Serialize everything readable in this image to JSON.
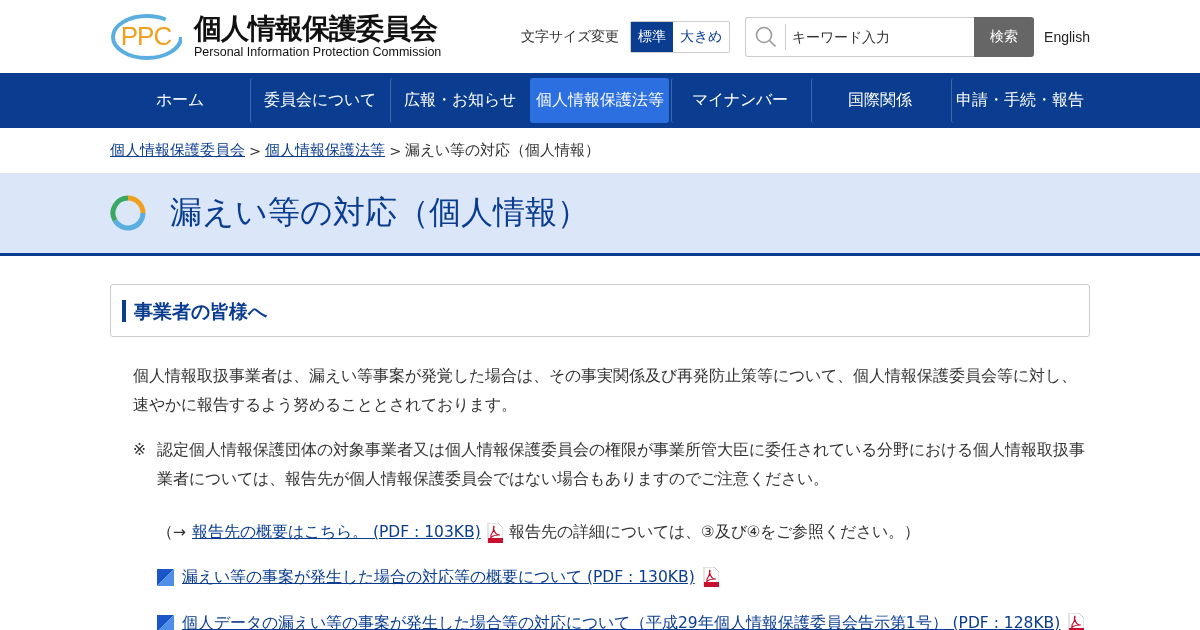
{
  "header": {
    "logo_mark": "PPC",
    "logo_title": "個人情報保護委員会",
    "logo_subtitle": "Personal Information Protection Commission",
    "font_size_label": "文字サイズ変更",
    "font_size_options": [
      {
        "label": "標準",
        "selected": true
      },
      {
        "label": "大きめ",
        "selected": false
      }
    ],
    "search": {
      "placeholder": "キーワード入力",
      "button": "検索"
    },
    "language_link": "English"
  },
  "nav": {
    "items": [
      {
        "label": "ホーム",
        "selected": false
      },
      {
        "label": "委員会について",
        "selected": false
      },
      {
        "label": "広報・お知らせ",
        "selected": false
      },
      {
        "label": "個人情報保護法等",
        "selected": true
      },
      {
        "label": "マイナンバー",
        "selected": false
      },
      {
        "label": "国際関係",
        "selected": false
      },
      {
        "label": "申請・手続・報告",
        "selected": false
      }
    ]
  },
  "breadcrumb": {
    "separator": ">",
    "items": [
      {
        "label": "個人情報保護委員会",
        "kind": "link"
      },
      {
        "label": "個人情報保護法等",
        "kind": "link"
      },
      {
        "label": "漏えい等の対応（個人情報）",
        "kind": "current"
      }
    ]
  },
  "page_title": "漏えい等の対応（個人情報）",
  "section": {
    "heading": "事業者の皆様へ",
    "intro": "個人情報取扱事業者は、漏えい等事案が発覚した場合は、その事実関係及び再発防止策等について、個人情報保護委員会等に対し、速やかに報告するよう努めることとされております。",
    "note": {
      "mark": "※",
      "text": "認定個人情報保護団体の対象事業者又は個人情報保護委員会の権限が事業所管大臣に委任されている分野における個人情報取扱事業者については、報告先が個人情報保護委員会ではない場合もありますのでご注意ください。"
    },
    "reference": {
      "prefix": "（→",
      "link": "報告先の概要はこちら。 (PDF : 103KB)",
      "suffix": "報告先の詳細については、③及び④をご参照ください。）"
    },
    "links": [
      {
        "label": "漏えい等の事案が発生した場合の対応等の概要について (PDF : 130KB)"
      },
      {
        "label": "個人データの漏えい等の事案が発生した場合等の対応について（平成29年個人情報保護委員会告示第1号） (PDF : 128KB)"
      }
    ]
  }
}
